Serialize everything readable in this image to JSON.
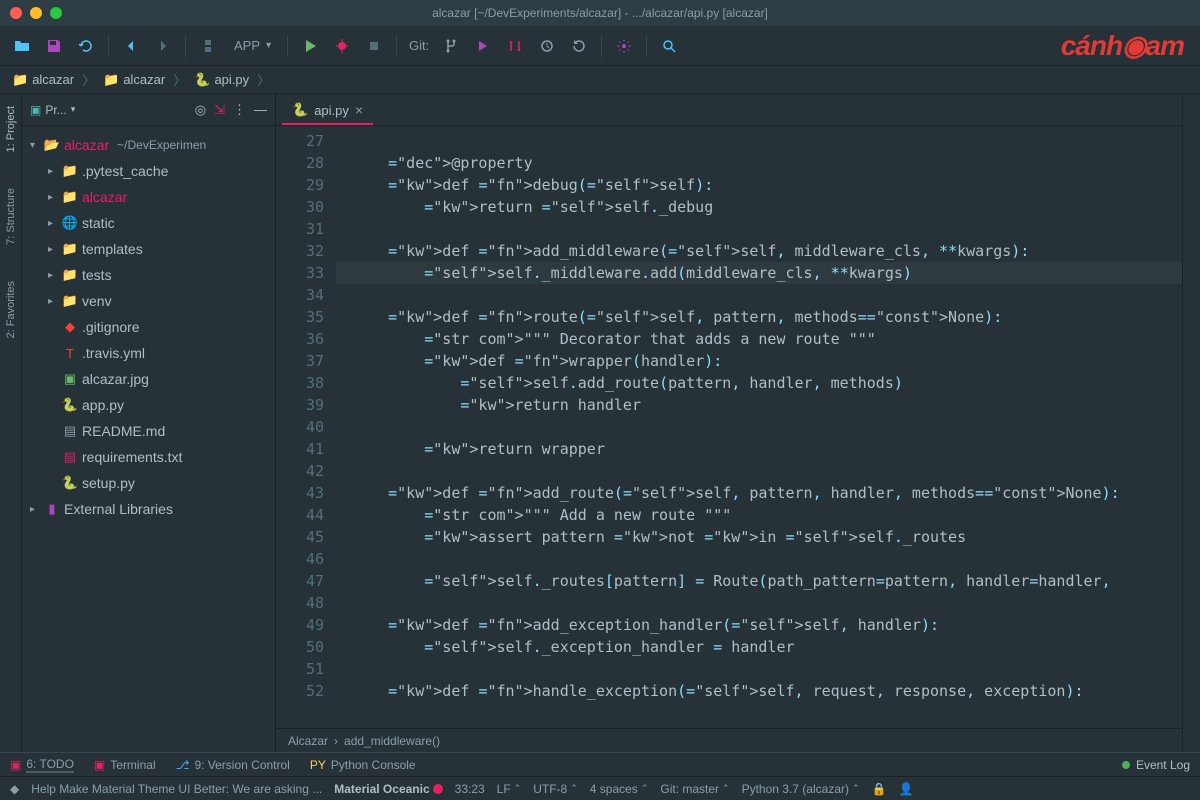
{
  "window": {
    "title": "alcazar [~/DevExperiments/alcazar] - .../alcazar/api.py [alcazar]"
  },
  "toolbar": {
    "run_config": "APP",
    "git_label": "Git:",
    "logo": "cánh◉am"
  },
  "breadcrumb": {
    "items": [
      "alcazar",
      "alcazar",
      "api.py"
    ]
  },
  "sidebar": {
    "title": "Pr...",
    "root": {
      "name": "alcazar",
      "path": "~/DevExperimen"
    },
    "tree": [
      {
        "label": ".pytest_cache",
        "icon": "folder",
        "color": "gray",
        "depth": 1,
        "exp": true
      },
      {
        "label": "alcazar",
        "icon": "folder",
        "color": "pink",
        "depth": 1,
        "exp": true,
        "bold": true
      },
      {
        "label": "static",
        "icon": "folder-web",
        "color": "blue",
        "depth": 1,
        "exp": true
      },
      {
        "label": "templates",
        "icon": "folder",
        "color": "yellow",
        "depth": 1,
        "exp": true
      },
      {
        "label": "tests",
        "icon": "folder",
        "color": "teal",
        "depth": 1,
        "exp": true
      },
      {
        "label": "venv",
        "icon": "folder",
        "color": "yellow",
        "depth": 1,
        "exp": true
      },
      {
        "label": ".gitignore",
        "icon": "git",
        "color": "red",
        "depth": 1
      },
      {
        "label": ".travis.yml",
        "icon": "travis",
        "color": "red",
        "depth": 1
      },
      {
        "label": "alcazar.jpg",
        "icon": "image",
        "color": "green",
        "depth": 1
      },
      {
        "label": "app.py",
        "icon": "python",
        "color": "yellow",
        "depth": 1
      },
      {
        "label": "README.md",
        "icon": "md",
        "color": "gray",
        "depth": 1
      },
      {
        "label": "requirements.txt",
        "icon": "txt",
        "color": "pink",
        "depth": 1
      },
      {
        "label": "setup.py",
        "icon": "python",
        "color": "yellow",
        "depth": 1
      }
    ],
    "ext_libs": "External Libraries"
  },
  "gutter_tabs": [
    "1: Project",
    "7: Structure",
    "2: Favorites"
  ],
  "editor": {
    "tab_name": "api.py",
    "first_line": 27,
    "highlight_line": 33,
    "lines": [
      "",
      "    @property",
      "    def debug(self):",
      "        return self._debug",
      "",
      "    def add_middleware(self, middleware_cls, **kwargs):",
      "        self._middleware.add(middleware_cls, **kwargs)",
      "",
      "    def route(self, pattern, methods=None):",
      "        \"\"\" Decorator that adds a new route \"\"\"",
      "        def wrapper(handler):",
      "            self.add_route(pattern, handler, methods)",
      "            return handler",
      "",
      "        return wrapper",
      "",
      "    def add_route(self, pattern, handler, methods=None):",
      "        \"\"\" Add a new route \"\"\"",
      "        assert pattern not in self._routes",
      "",
      "        self._routes[pattern] = Route(path_pattern=pattern, handler=handler,",
      "",
      "    def add_exception_handler(self, handler):",
      "        self._exception_handler = handler",
      "",
      "    def handle_exception(self, request, response, exception):"
    ],
    "crumb": [
      "Alcazar",
      "add_middleware()"
    ]
  },
  "bottom_tabs": {
    "todo": "6: TODO",
    "terminal": "Terminal",
    "vcs": "9: Version Control",
    "pyconsole": "Python Console",
    "event_log": "Event Log"
  },
  "statusbar": {
    "msg": "Help Make Material Theme UI Better: We are asking ...",
    "theme": "Material Oceanic",
    "pos": "33:23",
    "eol": "LF",
    "enc": "UTF-8",
    "indent": "4 spaces",
    "git": "Git: master",
    "python": "Python 3.7 (alcazar)"
  }
}
